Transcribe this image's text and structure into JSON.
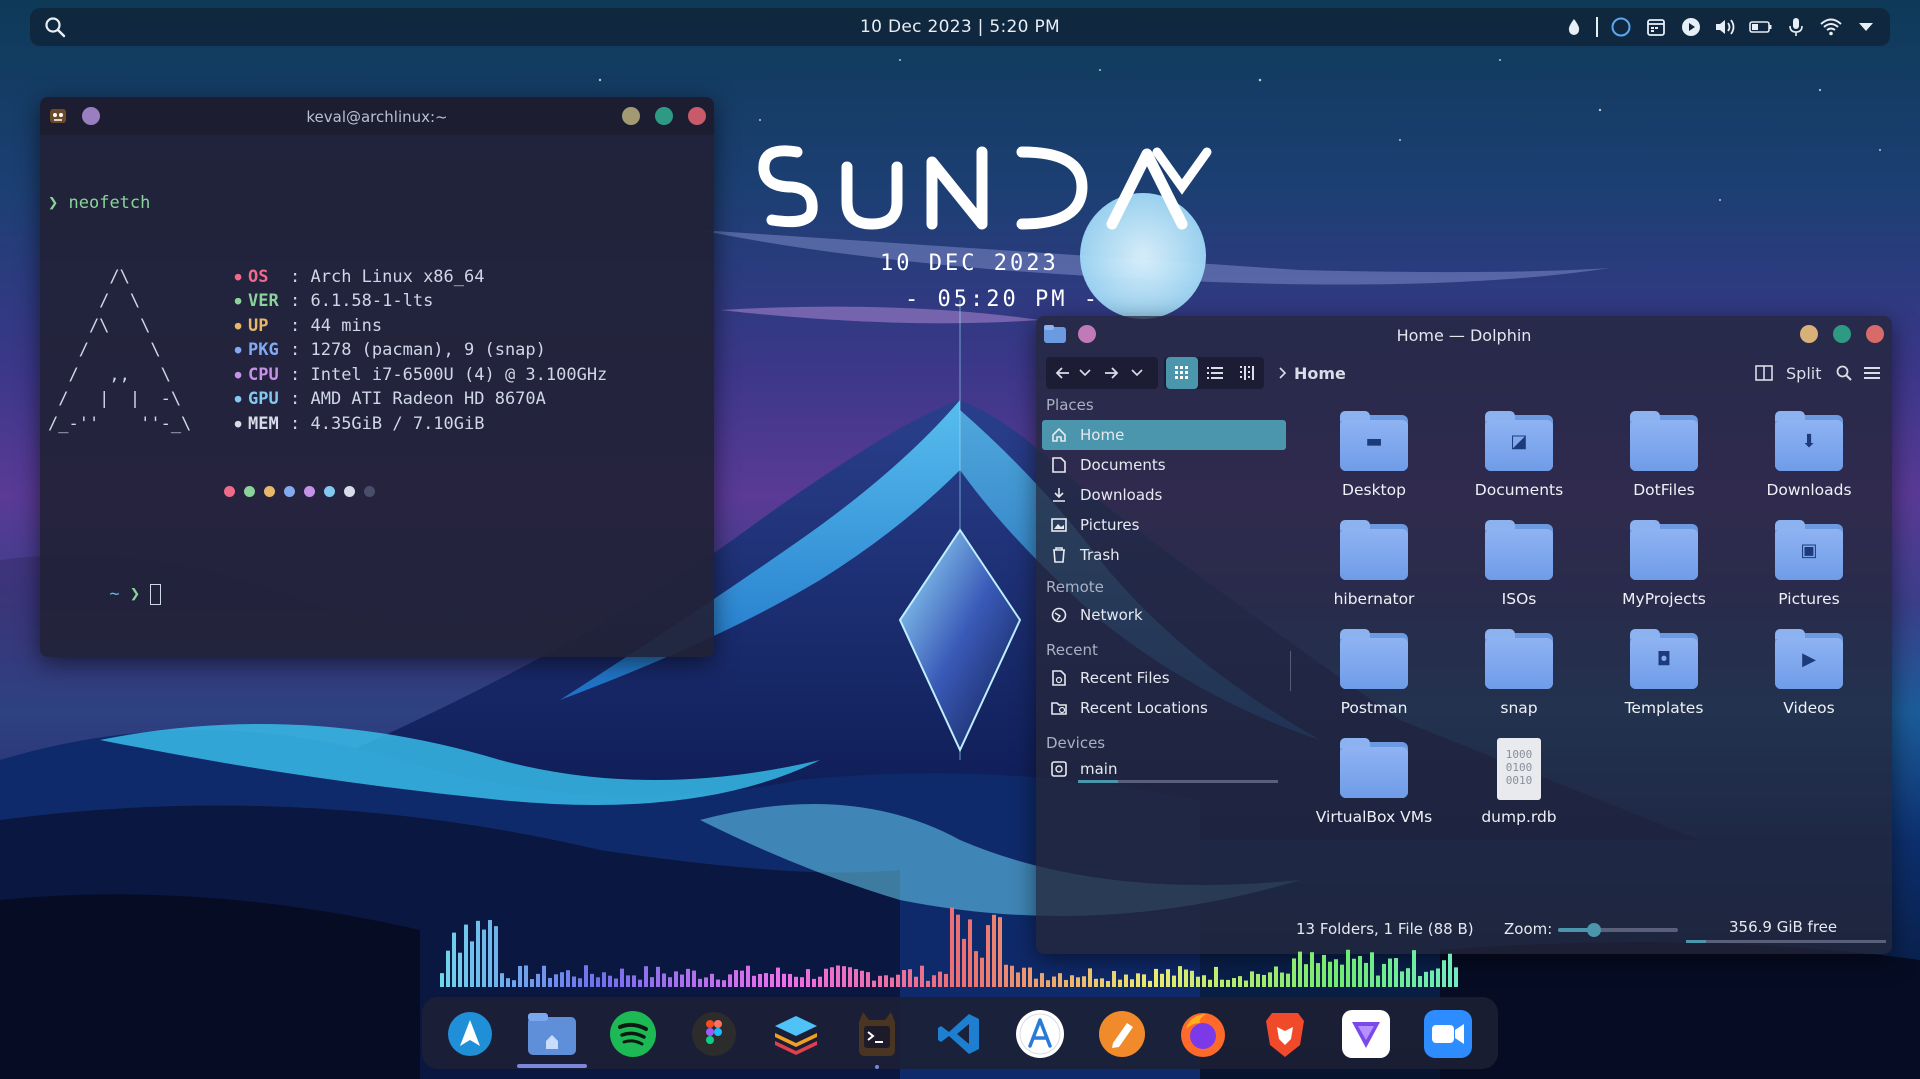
{
  "topbar": {
    "clock": "10 Dec 2023 | 5:20 PM",
    "tray_icons": [
      "drop-icon",
      "circle-icon",
      "calendar-icon",
      "play-icon",
      "volume-icon",
      "battery-icon",
      "microphone-icon",
      "wifi-icon",
      "chevron-down-icon"
    ]
  },
  "clock_widget": {
    "day": "SUNDAY",
    "date": "10 DEC 2023",
    "time": "- 05:20 PM -"
  },
  "terminal": {
    "title": "keval@archlinux:~",
    "command_prompt": "❯",
    "command": "neofetch",
    "logo_lines": [
      "      /\\",
      "     /  \\",
      "    /\\   \\",
      "   /      \\",
      "  /   ,,   \\",
      " /   |  |  -\\",
      "/_-''    ''-_\\"
    ],
    "info": [
      {
        "key": "OS",
        "value": "Arch Linux x86_64",
        "color": "#f06a8a"
      },
      {
        "key": "VER",
        "value": "6.1.58-1-lts",
        "color": "#8ad49a"
      },
      {
        "key": "UP",
        "value": "44 mins",
        "color": "#e8b86a"
      },
      {
        "key": "PKG",
        "value": "1278 (pacman), 9 (snap)",
        "color": "#82aaf0"
      },
      {
        "key": "CPU",
        "value": "Intel i7-6500U (4) @ 3.100GHz",
        "color": "#c592e8"
      },
      {
        "key": "GPU",
        "value": "AMD ATI Radeon HD 8670A",
        "color": "#82c8f0"
      },
      {
        "key": "MEM",
        "value": "4.35GiB / 7.10GiB",
        "color": "#d8dce8"
      }
    ],
    "palette": [
      "#f06a8a",
      "#8ad49a",
      "#e8b86a",
      "#82aaf0",
      "#c592e8",
      "#82c8f0",
      "#d8dce8",
      "#4a4e6a"
    ],
    "prompt_path": "~",
    "prompt_arrow": "❯"
  },
  "dolphin": {
    "title": "Home — Dolphin",
    "breadcrumb": "Home",
    "split_label": "Split",
    "sections": {
      "places": "Places",
      "remote": "Remote",
      "recent": "Recent",
      "devices": "Devices"
    },
    "places": [
      {
        "label": "Home",
        "icon": "home-icon"
      },
      {
        "label": "Documents",
        "icon": "document-icon"
      },
      {
        "label": "Downloads",
        "icon": "download-icon"
      },
      {
        "label": "Pictures",
        "icon": "image-icon"
      },
      {
        "label": "Trash",
        "icon": "trash-icon"
      }
    ],
    "remote": [
      {
        "label": "Network",
        "icon": "network-icon"
      }
    ],
    "recent": [
      {
        "label": "Recent Files",
        "icon": "recent-files-icon"
      },
      {
        "label": "Recent Locations",
        "icon": "recent-locations-icon"
      }
    ],
    "devices": [
      {
        "label": "main",
        "icon": "drive-icon",
        "usage": 0.2
      }
    ],
    "files": [
      {
        "name": "Desktop",
        "icon": "desktop-folder-icon"
      },
      {
        "name": "Documents",
        "icon": "documents-folder-icon"
      },
      {
        "name": "DotFiles",
        "icon": "folder-icon"
      },
      {
        "name": "Downloads",
        "icon": "downloads-folder-icon"
      },
      {
        "name": "hibernator",
        "icon": "folder-icon"
      },
      {
        "name": "ISOs",
        "icon": "folder-icon"
      },
      {
        "name": "MyProjects",
        "icon": "folder-icon"
      },
      {
        "name": "Pictures",
        "icon": "pictures-folder-icon"
      },
      {
        "name": "Postman",
        "icon": "folder-icon"
      },
      {
        "name": "snap",
        "icon": "folder-icon"
      },
      {
        "name": "Templates",
        "icon": "templates-folder-icon"
      },
      {
        "name": "Videos",
        "icon": "videos-folder-icon"
      },
      {
        "name": "VirtualBox VMs",
        "icon": "folder-icon"
      },
      {
        "name": "dump.rdb",
        "icon": "binary-file-icon",
        "glyph": "1000\n0100\n0010"
      }
    ],
    "status": {
      "summary": "13 Folders, 1 File (88 B)",
      "zoom_label": "Zoom:",
      "zoom_level": 0.3,
      "free_space": "356.9 GiB free",
      "space_used": 0.1
    }
  },
  "dock": {
    "apps": [
      {
        "name": "arch-store-icon",
        "color": "#1f8fd8"
      },
      {
        "name": "files-icon",
        "color": "#5f8fd8",
        "active": true
      },
      {
        "name": "spotify-icon",
        "color": "#1db954"
      },
      {
        "name": "figma-icon",
        "color": "#2c2c2c"
      },
      {
        "name": "layers-icon",
        "color": "#f0a020"
      },
      {
        "name": "terminal-icon",
        "color": "#3a2a1e",
        "running": true
      },
      {
        "name": "vscode-icon",
        "color": "#1e7fd0"
      },
      {
        "name": "app-store-icon",
        "color": "#ffffff"
      },
      {
        "name": "inkscape-pen-icon",
        "color": "#f08a2a"
      },
      {
        "name": "firefox-icon",
        "color": "#ff6a2a"
      },
      {
        "name": "brave-icon",
        "color": "#f04a2a"
      },
      {
        "name": "proton-vpn-icon",
        "color": "#ffffff"
      },
      {
        "name": "zoom-icon",
        "color": "#2d8cff"
      }
    ]
  }
}
